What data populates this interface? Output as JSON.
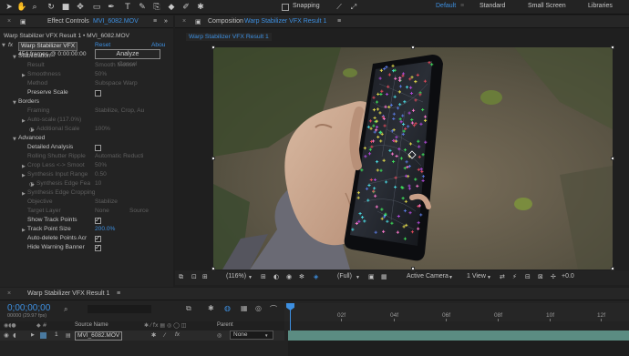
{
  "toolbar": {
    "snapping_label": "Snapping",
    "workspaces": [
      "Default",
      "Standard",
      "Small Screen",
      "Libraries"
    ],
    "active_workspace": "Default"
  },
  "effect_controls": {
    "tab_prefix": "Effect Controls",
    "tab_file": "MVI_6082.MOV",
    "breadcrumb": "Warp Stabilizer VFX Result 1 • MVI_6082.MOV",
    "effect": {
      "fx": "fx",
      "name": "Warp Stabilizer VFX",
      "reset": "Reset",
      "about": "Abou"
    },
    "frames_info": "454 frames @ 0:00:00:00",
    "analyze_label": "Analyze",
    "cancel_label": "Cancel",
    "sections": {
      "stabilization": "Stabilization",
      "borders": "Borders",
      "advanced": "Advanced"
    },
    "rows": [
      {
        "name": "Result",
        "value": "Smooth Motion",
        "dim": true
      },
      {
        "name": "Smoothness",
        "value": "50%",
        "dim": true
      },
      {
        "name": "Method",
        "value": "Subspace Warp",
        "dim": true
      },
      {
        "name": "Preserve Scale",
        "check": false
      },
      {
        "name": "Framing",
        "value": "Stabilize, Crop, Au",
        "dim": true
      },
      {
        "name": "Auto-scale (117.0%)",
        "value": "",
        "dim": true
      },
      {
        "name": "Additional Scale",
        "value": "100%",
        "dim": true
      },
      {
        "name": "Detailed Analysis",
        "check": false
      },
      {
        "name": "Rolling Shutter Ripple",
        "value": "Automatic Reducti",
        "dim": true
      },
      {
        "name": "Crop Less <-> Smoot",
        "value": "50%",
        "dim": true
      },
      {
        "name": "Synthesis Input Range",
        "value": "0.50",
        "dim": true
      },
      {
        "name": "Synthesis Edge Fea",
        "value": "10",
        "dim": true
      },
      {
        "name": "Synthesis Edge Cropping",
        "value": "",
        "dim": true
      },
      {
        "name": "Objective",
        "value": "Stabilize",
        "dim": true
      },
      {
        "name": "Target Layer",
        "value": "None",
        "value2": "Source",
        "dim": true
      },
      {
        "name": "Show Track Points",
        "check": true
      },
      {
        "name": "Track Point Size",
        "value": "200.0%",
        "blue": true
      },
      {
        "name": "Auto-delete Points Acr",
        "check": true
      },
      {
        "name": "Hide Warning Banner",
        "check": true
      }
    ]
  },
  "composition": {
    "tab_prefix": "Composition",
    "tab_name": "Warp Stabilizer VFX Result 1",
    "subtab": "Warp Stabilizer VFX Result 1",
    "footer": {
      "zoom": "(116%)",
      "resolution": "(Full)",
      "camera": "Active Camera",
      "view": "1 View",
      "exposure": "+0.0"
    }
  },
  "timeline": {
    "tab": "Warp Stabilizer VFX Result 1",
    "timecode": "0;00;00;00",
    "frame_info": "00000 (29.97 fps)",
    "columns": {
      "source": "Source Name",
      "parent": "Parent"
    },
    "layer": {
      "index": "1",
      "name": "MVI_6082.MOV",
      "parent": "None"
    },
    "ruler": [
      "02f",
      "04f",
      "06f",
      "08f",
      "10f",
      "12f"
    ]
  },
  "track_points": {
    "count": 180,
    "colors": [
      "#3fe05a",
      "#b04ad8",
      "#e04a5a",
      "#e0d84a",
      "#4ad8e0",
      "#5a7ae0",
      "#ff7ad0"
    ]
  }
}
